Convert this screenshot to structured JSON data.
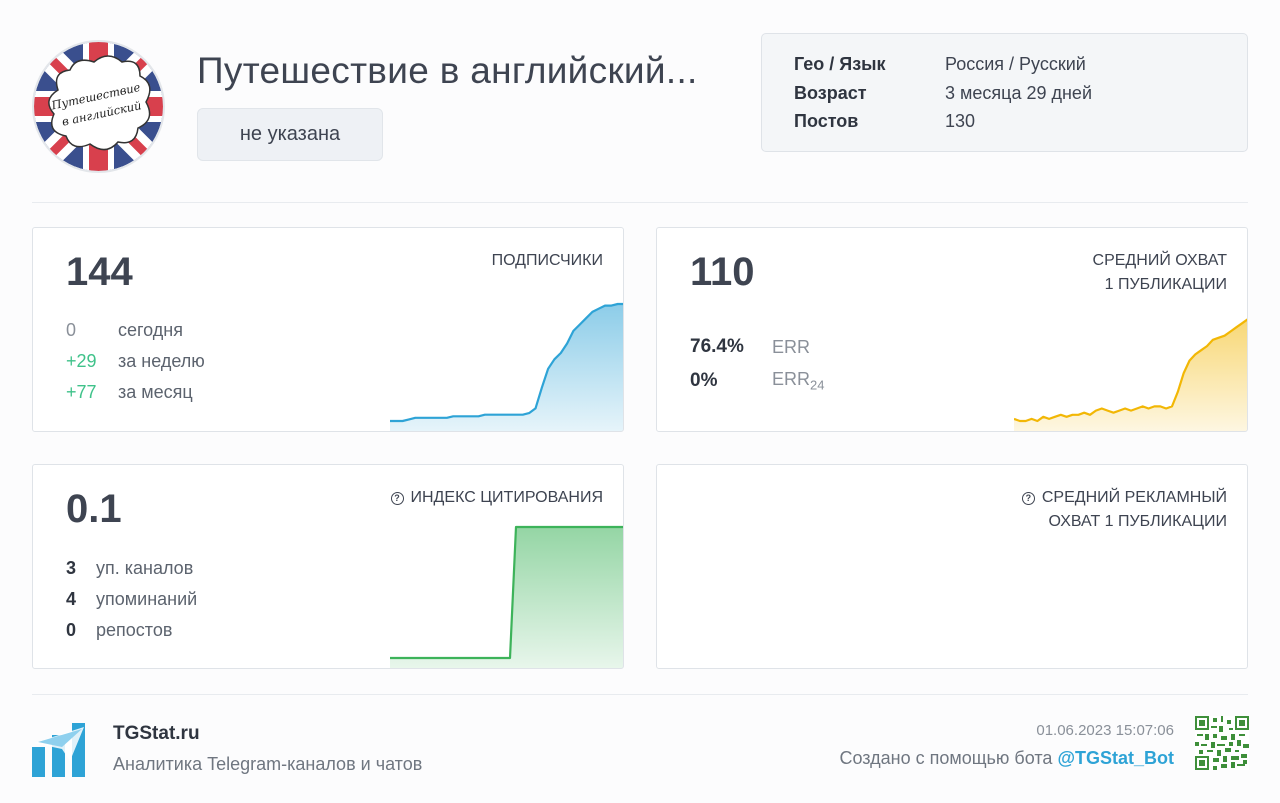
{
  "channel": {
    "title": "Путешествие в английский...",
    "avatar_text_line1": "Путешествие",
    "avatar_text_line2": "в английский",
    "category": "не указана"
  },
  "info": {
    "rows": [
      {
        "key": "Гео / Язык",
        "value": "Россия / Русский"
      },
      {
        "key": "Возраст",
        "value": "3 месяца 29 дней"
      },
      {
        "key": "Постов",
        "value": "130"
      }
    ]
  },
  "subscribers": {
    "value": "144",
    "label": "ПОДПИСЧИКИ",
    "stats": [
      {
        "num": "0",
        "text": "сегодня"
      },
      {
        "num": "+29",
        "text": "за неделю"
      },
      {
        "num": "+77",
        "text": "за месяц"
      }
    ],
    "color": "#2ea3d6",
    "trend": [
      67,
      67,
      67,
      68,
      69,
      69,
      69,
      69,
      69,
      69,
      70,
      70,
      70,
      70,
      70,
      71,
      71,
      71,
      71,
      71,
      71,
      71,
      72,
      75,
      88,
      100,
      106,
      110,
      116,
      124,
      128,
      132,
      136,
      138,
      140,
      140,
      141,
      141
    ]
  },
  "reach": {
    "value": "110",
    "label_line1": "СРЕДНИЙ ОХВАТ",
    "label_line2": "1 ПУБЛИКАЦИИ",
    "err_value": "76.4%",
    "err_label": "ERR",
    "err24_value": "0%",
    "err24_label_main": "ERR",
    "err24_label_sub": "24",
    "color": "#f2b705",
    "trend": [
      62,
      61,
      61,
      62,
      61,
      63,
      62,
      63,
      64,
      63,
      64,
      64,
      65,
      64,
      66,
      67,
      66,
      65,
      66,
      67,
      66,
      67,
      68,
      67,
      68,
      68,
      67,
      68,
      75,
      84,
      90,
      93,
      95,
      97,
      100,
      101,
      102,
      104,
      106,
      108,
      110
    ]
  },
  "citation": {
    "value": "0.1",
    "label": "ИНДЕКС ЦИТИРОВАНИЯ",
    "stats": [
      {
        "num": "3",
        "text": "уп. каналов"
      },
      {
        "num": "4",
        "text": "упоминаний"
      },
      {
        "num": "0",
        "text": "репостов"
      }
    ],
    "color": "#3db35a",
    "trend": [
      0,
      0,
      0,
      0,
      0,
      0,
      0,
      0,
      0,
      0,
      0,
      0,
      0,
      0,
      0,
      0,
      0,
      0,
      0,
      0,
      0,
      1,
      1,
      1,
      1,
      1,
      1,
      1,
      1,
      1,
      1,
      1,
      1,
      1,
      1,
      1,
      1,
      1,
      1,
      1
    ]
  },
  "ad_reach": {
    "label_line1": "СРЕДНИЙ РЕКЛАМНЫЙ",
    "label_line2": "ОХВАТ 1 ПУБЛИКАЦИИ"
  },
  "footer": {
    "brand": "TGStat.ru",
    "tagline": "Аналитика Telegram-каналов и чатов",
    "timestamp": "01.06.2023 15:07:06",
    "credit_text": "Создано с помощью бота",
    "bot_handle": "@TGStat_Bot"
  },
  "icons": [
    "union-jack-avatar",
    "question-circle-icon",
    "tgstat-logo-icon",
    "qr-code-icon"
  ]
}
